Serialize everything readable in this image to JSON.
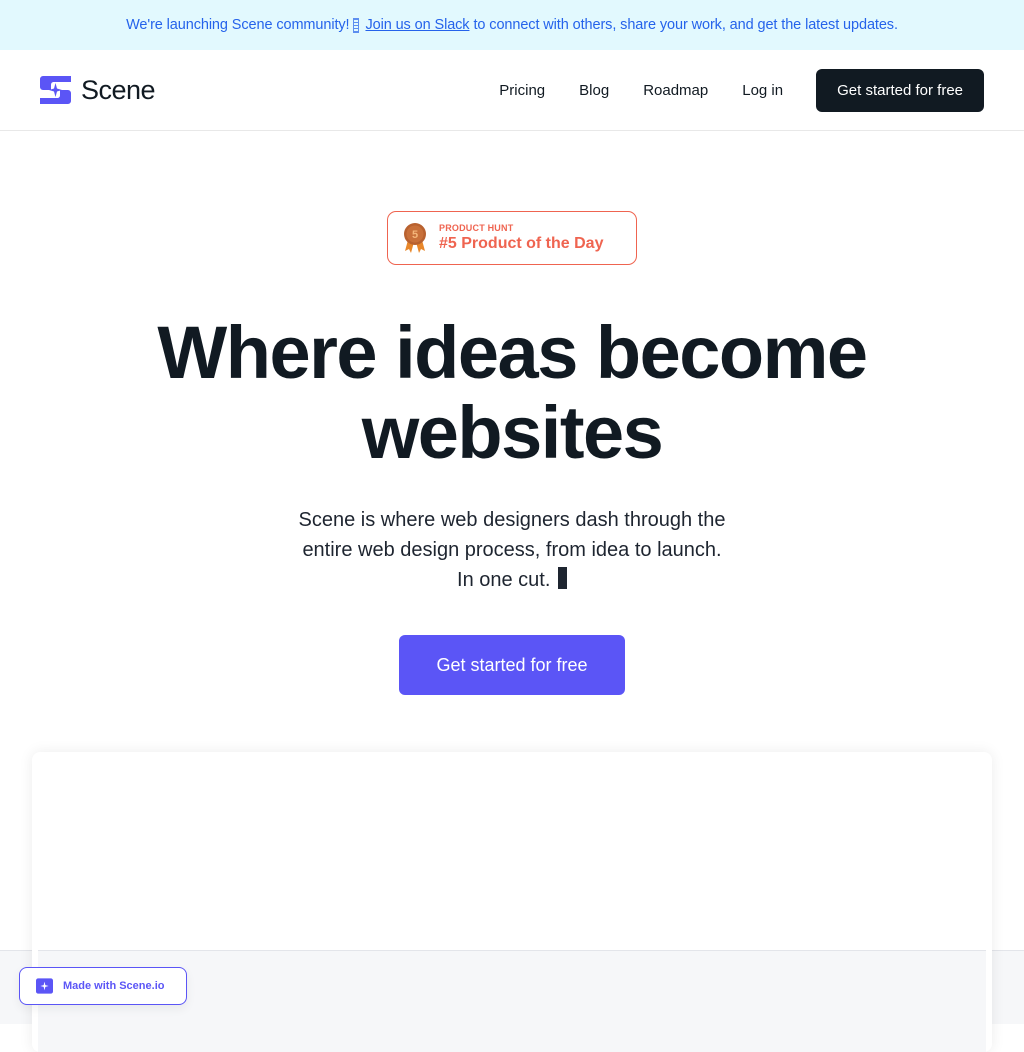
{
  "announcement": {
    "text_before": "We're launching Scene community!",
    "emoji": "party-icon",
    "link_label": "Join us on Slack",
    "text_after": "to connect with others, share your work, and get the latest updates."
  },
  "header": {
    "logo_text": "Scene",
    "nav": [
      {
        "label": "Pricing"
      },
      {
        "label": "Blog"
      },
      {
        "label": "Roadmap"
      },
      {
        "label": "Log in"
      }
    ],
    "cta_label": "Get started for free"
  },
  "hero": {
    "badge": {
      "kicker": "PRODUCT HUNT",
      "title": "#5 Product of the Day",
      "medal_number": "5"
    },
    "headline_line1": "Where ideas become",
    "headline_line2": "websites",
    "subtitle": "Scene is where web designers dash through the entire web design process, from idea to launch. In one cut.",
    "subtitle_emoji": "clapper-icon",
    "cta_label": "Get started for free"
  },
  "made_with": {
    "label": "Made with Scene.io"
  },
  "colors": {
    "brand": "#5b55f6",
    "dark": "#111a22",
    "announce_bg": "#e2f9fe",
    "announce_text": "#2563eb",
    "product_hunt": "#ef6450"
  }
}
